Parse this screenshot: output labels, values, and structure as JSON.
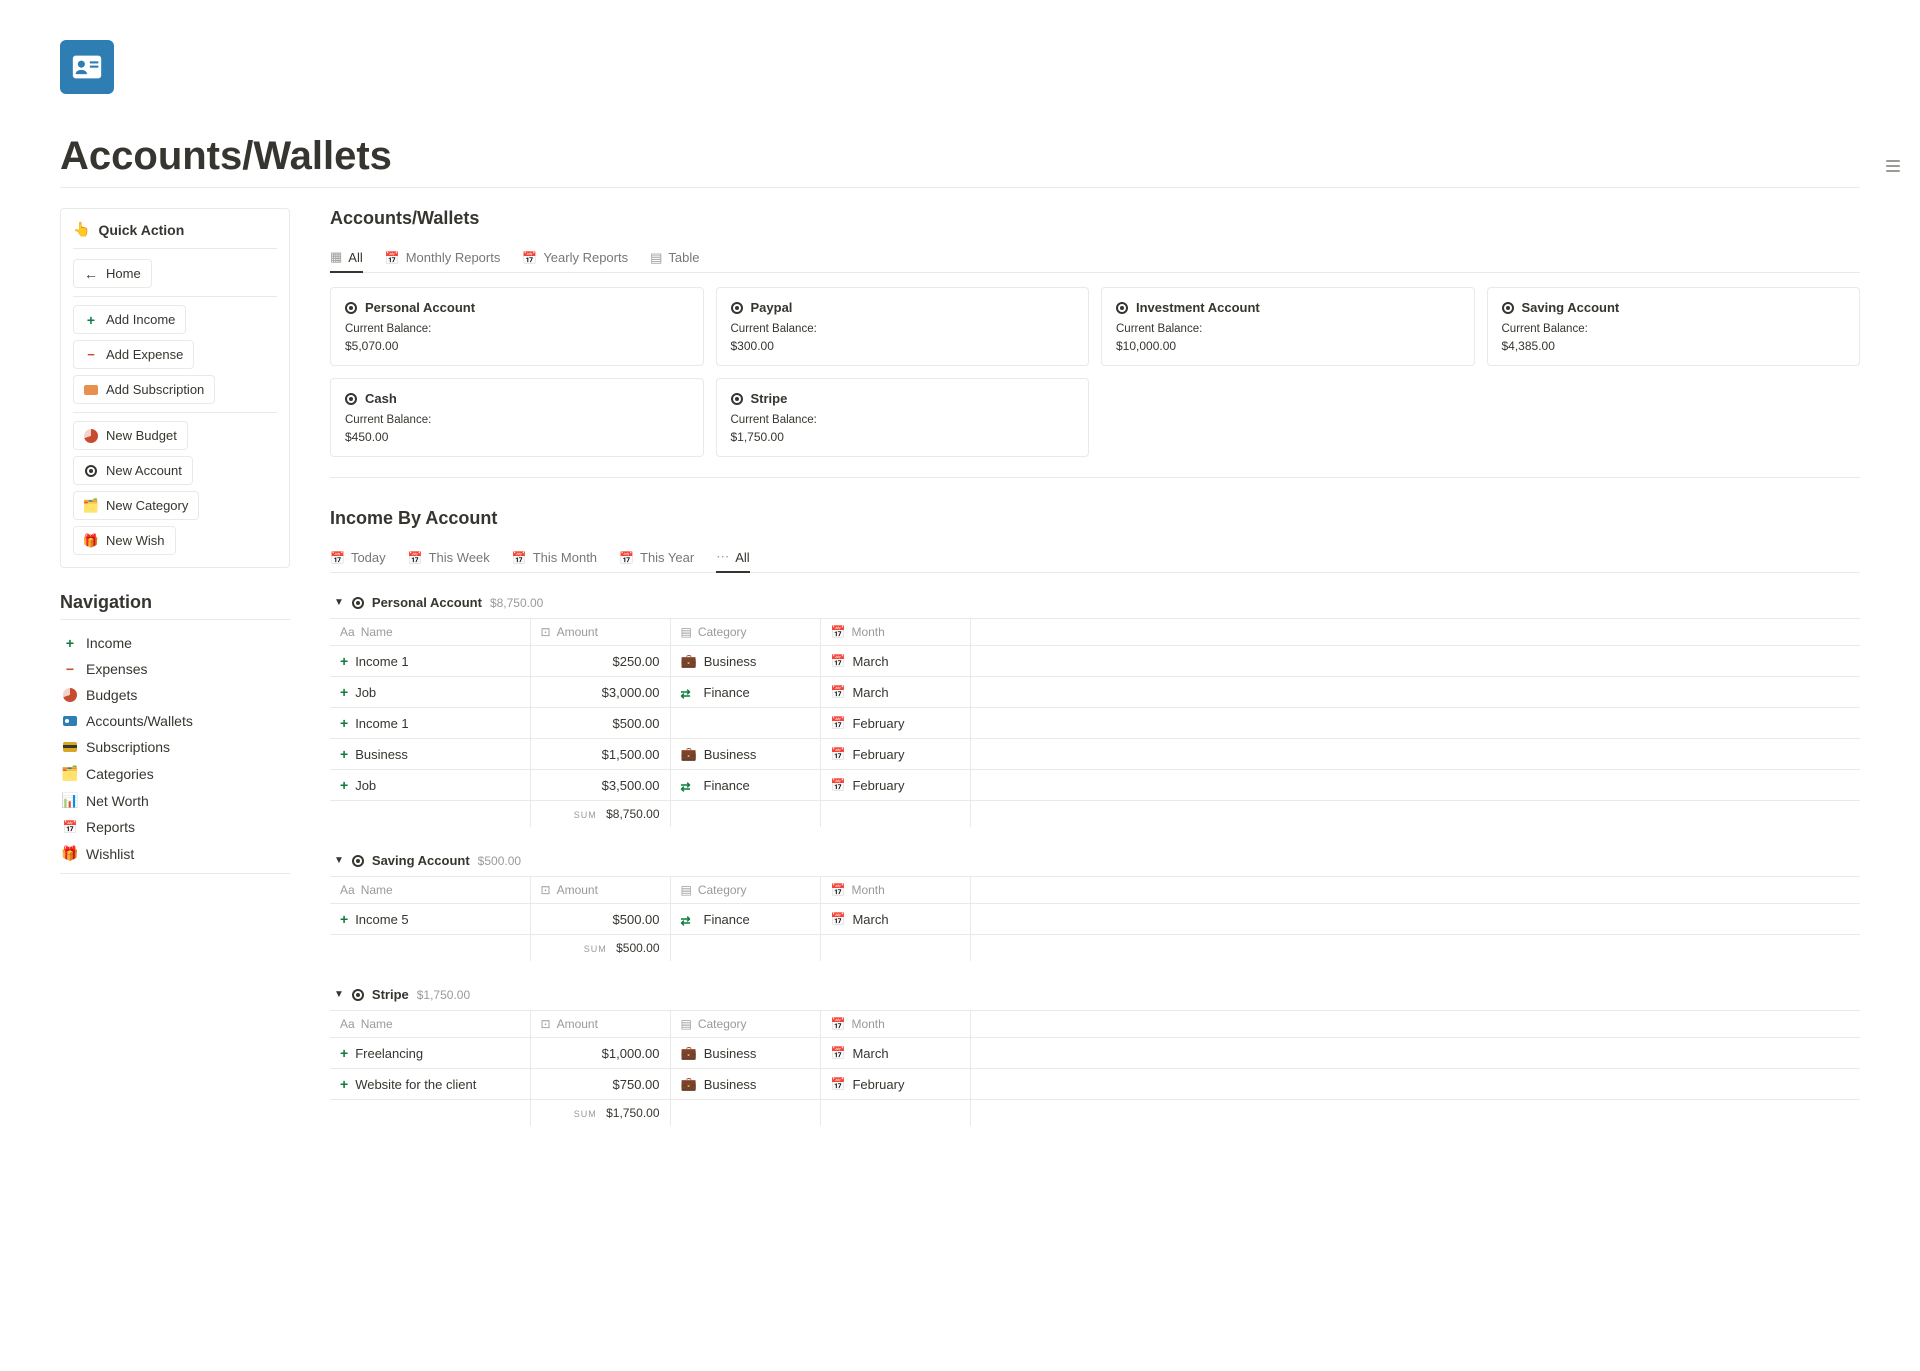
{
  "page": {
    "title": "Accounts/Wallets"
  },
  "quickAction": {
    "title": "Quick Action",
    "home": "Home",
    "addIncome": "Add Income",
    "addExpense": "Add Expense",
    "addSubscription": "Add Subscription",
    "newBudget": "New Budget",
    "newAccount": "New Account",
    "newCategory": "New Category",
    "newWish": "New Wish"
  },
  "navigation": {
    "title": "Navigation",
    "items": {
      "income": "Income",
      "expenses": "Expenses",
      "budgets": "Budgets",
      "accounts": "Accounts/Wallets",
      "subscriptions": "Subscriptions",
      "categories": "Categories",
      "networth": "Net Worth",
      "reports": "Reports",
      "wishlist": "Wishlist"
    }
  },
  "accountTabs": {
    "all": "All",
    "monthly": "Monthly Reports",
    "yearly": "Yearly Reports",
    "table": "Table"
  },
  "sectionTitles": {
    "accounts": "Accounts/Wallets",
    "income": "Income By Account"
  },
  "balanceLabel": "Current Balance:",
  "accounts": [
    {
      "name": "Personal Account",
      "balance": "$5,070.00"
    },
    {
      "name": "Paypal",
      "balance": "$300.00"
    },
    {
      "name": "Investment Account",
      "balance": "$10,000.00"
    },
    {
      "name": "Saving Account",
      "balance": "$4,385.00"
    },
    {
      "name": "Cash",
      "balance": "$450.00"
    },
    {
      "name": "Stripe",
      "balance": "$1,750.00"
    }
  ],
  "incomeTabs": {
    "today": "Today",
    "week": "This Week",
    "month": "This Month",
    "year": "This Year",
    "all": "All"
  },
  "columns": {
    "name": "Name",
    "amount": "Amount",
    "category": "Category",
    "month": "Month"
  },
  "sumLabel": "SUM",
  "groups": [
    {
      "name": "Personal Account",
      "total": "$8,750.00",
      "rows": [
        {
          "name": "Income 1",
          "amount": "$250.00",
          "category": "Business",
          "catIcon": "briefcase",
          "month": "March"
        },
        {
          "name": "Job",
          "amount": "$3,000.00",
          "category": "Finance",
          "catIcon": "finance",
          "month": "March"
        },
        {
          "name": "Income 1",
          "amount": "$500.00",
          "category": "",
          "catIcon": "",
          "month": "February"
        },
        {
          "name": "Business",
          "amount": "$1,500.00",
          "category": "Business",
          "catIcon": "briefcase",
          "month": "February"
        },
        {
          "name": "Job",
          "amount": "$3,500.00",
          "category": "Finance",
          "catIcon": "finance",
          "month": "February"
        }
      ],
      "sum": "$8,750.00"
    },
    {
      "name": "Saving Account",
      "total": "$500.00",
      "rows": [
        {
          "name": "Income 5",
          "amount": "$500.00",
          "category": "Finance",
          "catIcon": "finance",
          "month": "March"
        }
      ],
      "sum": "$500.00"
    },
    {
      "name": "Stripe",
      "total": "$1,750.00",
      "rows": [
        {
          "name": "Freelancing",
          "amount": "$1,000.00",
          "category": "Business",
          "catIcon": "briefcase",
          "month": "March"
        },
        {
          "name": "Website for the client",
          "amount": "$750.00",
          "category": "Business",
          "catIcon": "briefcase",
          "month": "February"
        }
      ],
      "sum": "$1,750.00"
    }
  ]
}
